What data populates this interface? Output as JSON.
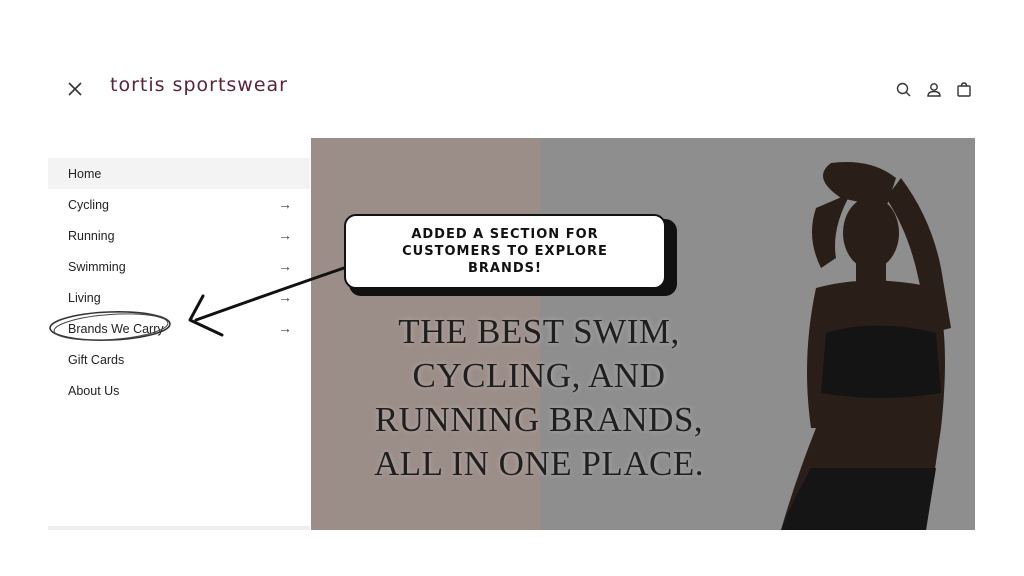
{
  "header": {
    "brand": "tortis sportswear",
    "icons": [
      "close-icon",
      "search-icon",
      "account-icon",
      "cart-icon"
    ]
  },
  "menu": {
    "items": [
      {
        "label": "Home",
        "has_arrow": false,
        "active": true
      },
      {
        "label": "Cycling",
        "has_arrow": true
      },
      {
        "label": "Running",
        "has_arrow": true
      },
      {
        "label": "Swimming",
        "has_arrow": true
      },
      {
        "label": "Living",
        "has_arrow": true
      },
      {
        "label": "Brands We Carry",
        "has_arrow": true,
        "circled": true
      },
      {
        "label": "Gift Cards",
        "has_arrow": false
      },
      {
        "label": "About Us",
        "has_arrow": false
      }
    ],
    "arrow_glyph": "→"
  },
  "hero": {
    "heading_lines": [
      "THE BEST SWIM,",
      "CYCLING, AND",
      "RUNNING BRANDS,",
      "ALL IN ONE PLACE."
    ]
  },
  "annotation": {
    "callout_lines": [
      "Added a section for",
      "customers to explore",
      "brands!"
    ]
  },
  "colors": {
    "brand": "#5a2436",
    "hero_left": "#9b8d88",
    "hero_right": "#8e8e8e"
  }
}
